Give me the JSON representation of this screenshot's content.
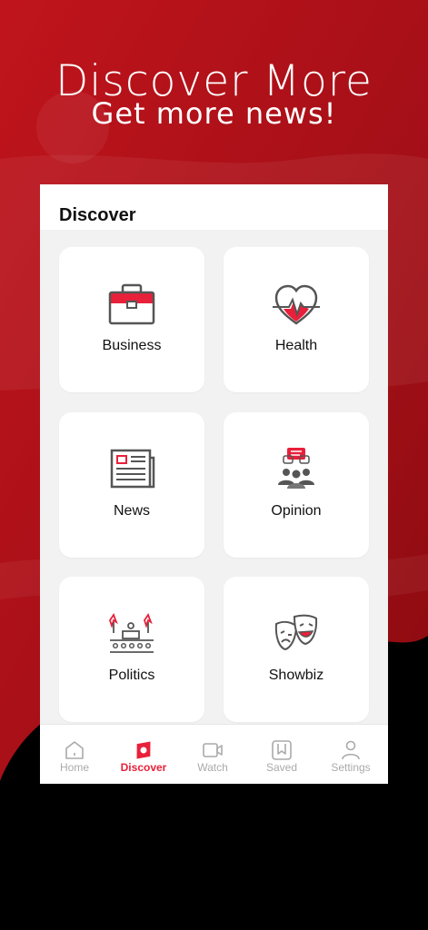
{
  "hero": {
    "title": "Discover More",
    "subtitle": "Get more news!"
  },
  "header": {
    "title": "Discover"
  },
  "categories": [
    {
      "label": "Business",
      "icon": "briefcase-icon"
    },
    {
      "label": "Health",
      "icon": "heart-pulse-icon"
    },
    {
      "label": "News",
      "icon": "newspaper-icon"
    },
    {
      "label": "Opinion",
      "icon": "people-chat-icon"
    },
    {
      "label": "Politics",
      "icon": "podium-crowd-icon"
    },
    {
      "label": "Showbiz",
      "icon": "theater-masks-icon"
    }
  ],
  "tabs": [
    {
      "label": "Home",
      "icon": "home-icon",
      "active": false
    },
    {
      "label": "Discover",
      "icon": "discover-icon",
      "active": true
    },
    {
      "label": "Watch",
      "icon": "video-icon",
      "active": false
    },
    {
      "label": "Saved",
      "icon": "bookmark-icon",
      "active": false
    },
    {
      "label": "Settings",
      "icon": "person-icon",
      "active": false
    }
  ],
  "colors": {
    "accent": "#e8203a",
    "background_red": "#b3121a",
    "icon_gray": "#555555"
  }
}
